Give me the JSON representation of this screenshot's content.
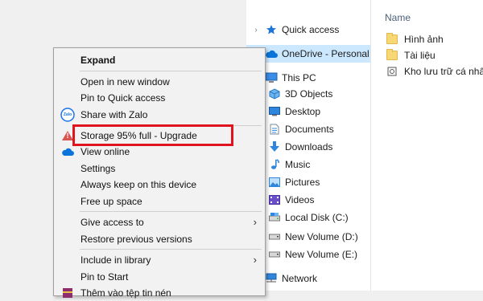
{
  "explorer": {
    "nav": [
      {
        "label": "Quick access",
        "icon": "star-icon"
      },
      {
        "label": "OneDrive - Personal",
        "icon": "cloud-icon"
      },
      {
        "label": "This PC",
        "icon": "computer-icon"
      },
      {
        "label": "3D Objects",
        "icon": "cube-icon"
      },
      {
        "label": "Desktop",
        "icon": "desktop-icon"
      },
      {
        "label": "Documents",
        "icon": "document-icon"
      },
      {
        "label": "Downloads",
        "icon": "download-icon"
      },
      {
        "label": "Music",
        "icon": "music-icon"
      },
      {
        "label": "Pictures",
        "icon": "picture-icon"
      },
      {
        "label": "Videos",
        "icon": "video-icon"
      },
      {
        "label": "Local Disk (C:)",
        "icon": "drive-icon"
      },
      {
        "label": "New Volume (D:)",
        "icon": "drive-icon"
      },
      {
        "label": "New Volume (E:)",
        "icon": "drive-icon"
      },
      {
        "label": "Network",
        "icon": "network-icon"
      }
    ],
    "files": {
      "column_header": "Name",
      "items": [
        {
          "label": "Hình ảnh",
          "icon": "folder-icon"
        },
        {
          "label": "Tài liệu",
          "icon": "folder-icon"
        },
        {
          "label": "Kho lưu trữ cá nhân",
          "icon": "vault-icon"
        }
      ]
    }
  },
  "context_menu": {
    "items": {
      "expand": "Expand",
      "open_new_window": "Open in new window",
      "pin_quick_access": "Pin to Quick access",
      "share_zalo": "Share with Zalo",
      "storage_warning": "Storage 95% full - Upgrade",
      "view_online": "View online",
      "settings": "Settings",
      "always_keep": "Always keep on this device",
      "free_up_space": "Free up space",
      "give_access": "Give access to",
      "restore_versions": "Restore previous versions",
      "include_library": "Include in library",
      "pin_start": "Pin to Start",
      "partial_last": "Thêm vào tệp tin nén"
    },
    "zalo_badge": "Zalo",
    "warning_glyph": "!"
  },
  "colors": {
    "highlight_border": "#e0141e",
    "selection": "#cce8ff",
    "onedrive_blue": "#0a74da",
    "warning": "#d9534f"
  }
}
